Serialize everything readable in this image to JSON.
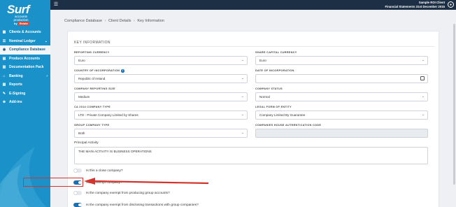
{
  "brand": {
    "name": "Surf",
    "tagline": "accounts production",
    "by_label": "by",
    "vendor": "Relate"
  },
  "sidebar": {
    "items": [
      {
        "label": "Clients & Accounts",
        "icon": "grid-icon",
        "active": false,
        "has_chevron": false
      },
      {
        "label": "Nominal Ledger",
        "icon": "ledger-icon",
        "active": false,
        "has_chevron": true
      },
      {
        "label": "Compliance Database",
        "icon": "database-icon",
        "active": true,
        "has_chevron": false
      },
      {
        "label": "Produce Accounts",
        "icon": "document-icon",
        "active": false,
        "has_chevron": false
      },
      {
        "label": "Documentation Pack",
        "icon": "pack-icon",
        "active": false,
        "has_chevron": false
      },
      {
        "label": "Banking",
        "icon": "bank-icon",
        "active": false,
        "has_chevron": true
      },
      {
        "label": "Reports",
        "icon": "reports-icon",
        "active": false,
        "has_chevron": false
      },
      {
        "label": "E-Signing",
        "icon": "pen-icon",
        "active": false,
        "has_chevron": false
      },
      {
        "label": "Add-ins",
        "icon": "plus-icon",
        "active": false,
        "has_chevron": false
      }
    ]
  },
  "topbar": {
    "client_name": "Sample ROI Client",
    "period": "Financial Statements 31st December 2015"
  },
  "breadcrumb": [
    "Compliance Database",
    "Client Details",
    "Key Information"
  ],
  "panel": {
    "title": "KEY INFORMATION",
    "fields": {
      "reporting_currency": {
        "label": "REPORTING CURRENCY",
        "value": "Euro"
      },
      "share_capital_currency": {
        "label": "SHARE CAPITAL CURRENCY",
        "value": "Euro"
      },
      "country_of_incorporation": {
        "label": "COUNTRY OF INCORPORATION",
        "value": "Republic of Ireland"
      },
      "date_of_incorporation": {
        "label": "DATE OF INCORPORATION",
        "value": ""
      },
      "company_reporting_size": {
        "label": "COMPANY REPORTING SIZE",
        "value": "Medium"
      },
      "company_status": {
        "label": "COMPANY STATUS",
        "value": "Normal"
      },
      "ca2014_company_type": {
        "label": "CA 2014 COMPANY TYPE",
        "value": "LTD - Private Company Limited by Shares"
      },
      "legal_form_of_entity": {
        "label": "LEGAL FORM OF ENTITY",
        "value": "Company Limited By Guarantee"
      },
      "group_company_type": {
        "label": "GROUP COMPANY TYPE",
        "value": "Both"
      },
      "companies_house_auth_code": {
        "label": "COMPANIES HOUSE AUTHENTICATION CODE",
        "value": ""
      }
    },
    "principal_activity": {
      "label": "Principal Activity",
      "value": "THE MAIN ACTIVITY IS BUSINESS OPERATIONS"
    },
    "toggles": [
      {
        "label": "Is this a close company?",
        "on": false
      },
      {
        "label": "Audit exempt company?",
        "on": true
      },
      {
        "label": "Is the company exempt from producing group accounts?",
        "on": false
      },
      {
        "label": "Is the company exempt from disclosing transactions with group companies?",
        "on": true
      }
    ]
  },
  "colors": {
    "sidebar": "#1a92c9",
    "topbar": "#1d2f45",
    "toggle_on": "#1a6fb5",
    "highlight": "#d4342c"
  }
}
